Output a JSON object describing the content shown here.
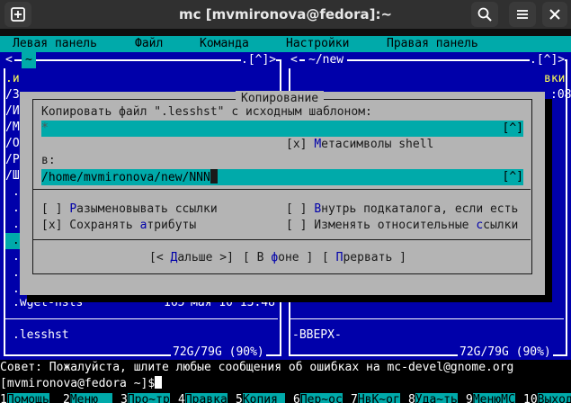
{
  "window": {
    "title": "mc [mvmironova@fedora]:~",
    "new_tab_icon": "plus-square",
    "search_icon": "magnifier",
    "menu_icon": "hamburger",
    "close_icon": "x"
  },
  "menu": [
    "Левая панель",
    "Файл",
    "Команда",
    "Настройки",
    "Правая панель"
  ],
  "left_panel": {
    "path": "~",
    "corner": ".[^]>",
    "hist": "<",
    "rows": [
      "/",
      "/",
      "/",
      "/",
      "/",
      "/",
      "/"
    ],
    "rows_chars": [
      ".и",
      "/3",
      "/И",
      "/М",
      "/О",
      "/Р",
      "/Ш"
    ],
    "bottom_file": ".wget-hsts",
    "bottom_size": "165",
    "bottom_date": "мая 10 13:48",
    "selected": ".lesshst",
    "disk": "72G/79G (90%)"
  },
  "right_panel": {
    "path": "~/new",
    "corner": ".[^]>",
    "hist": "<",
    "header_tail": "вки",
    "time_tail": ":08",
    "selected": "-ВВЕРХ-",
    "disk": "72G/79G (90%)"
  },
  "dialog": {
    "title": "Копирование",
    "source_label": "Копировать файл \".lesshst\" с исходным шаблоном:",
    "source_value": "*",
    "history_btn": "[^]",
    "metachars": "[x] Метасимволы shell",
    "dest_label": "в:",
    "dest_value": "/home/mvmironova/new/NNN",
    "opt_deref": "[ ] Разыменовывать ссылки",
    "opt_attrs": "[x] Сохранять атрибуты",
    "opt_into": "[ ] Внутрь подкаталога, если есть",
    "opt_relative": "[ ] Изменять относительные ссылки",
    "btn_next": "[< Дальше >]",
    "btn_bg": "[ В фоне ]",
    "btn_abort": "[ Прервать ]"
  },
  "status": "Совет: Пожалуйста, шлите любые сообщения об ошибках на mc-devel@gnome.org",
  "prompt": "[mvmironova@fedora ~]$",
  "fkeys": [
    {
      "n": "1",
      "label": "Помощь"
    },
    {
      "n": "2",
      "label": "Меню  "
    },
    {
      "n": "3",
      "label": "Про~тр"
    },
    {
      "n": "4",
      "label": "Правка"
    },
    {
      "n": "5",
      "label": "Копия "
    },
    {
      "n": "6",
      "label": "Пер~ос"
    },
    {
      "n": "7",
      "label": "НвК~ог"
    },
    {
      "n": "8",
      "label": "Уда~ть"
    },
    {
      "n": "9",
      "label": "МенюMC"
    },
    {
      "n": "10",
      "label": "Выход"
    }
  ],
  "colors": {
    "panel_bg": "#0000aa",
    "accent_cyan": "#00aaaa",
    "dialog_bg": "#b4b4b4",
    "highlight_yellow": "#ffff55"
  }
}
